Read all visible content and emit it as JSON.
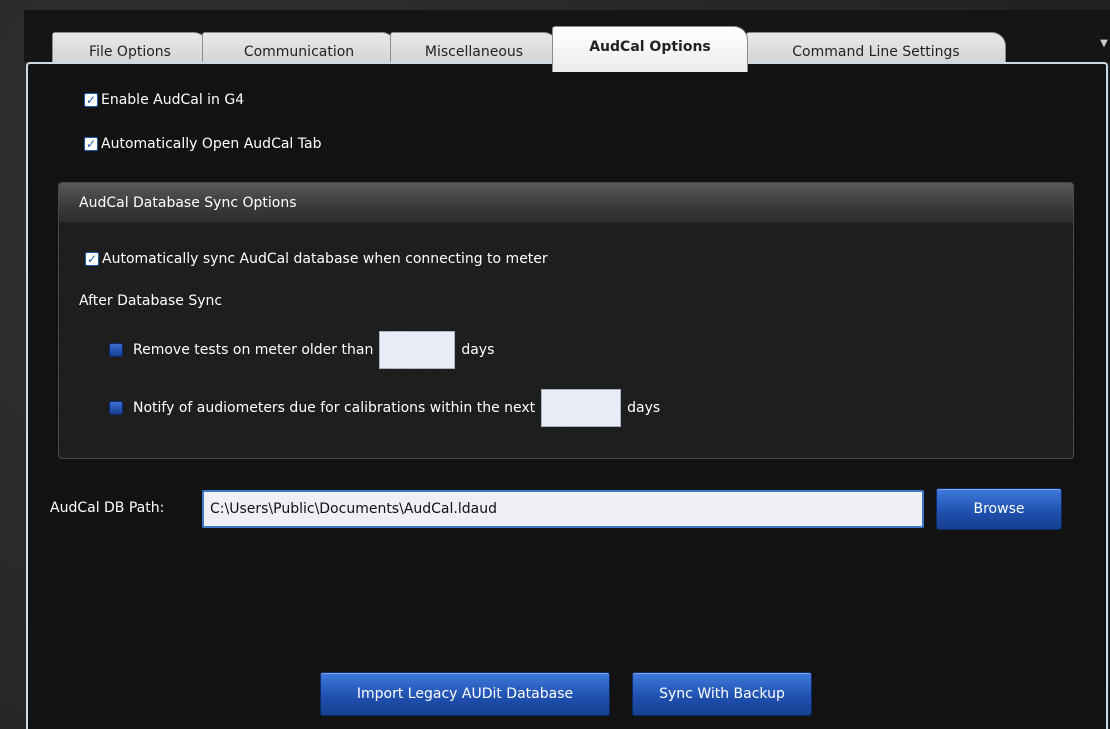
{
  "tabs": [
    {
      "label": "File Options"
    },
    {
      "label": "Communication"
    },
    {
      "label": "Miscellaneous"
    },
    {
      "label": "AudCal Options",
      "active": true
    },
    {
      "label": "Command Line Settings"
    }
  ],
  "tab_overflow_icon": "chevron-down-icon",
  "options": {
    "enable_audcal": {
      "label": "Enable AudCal in G4",
      "checked": true
    },
    "auto_open_tab": {
      "label": "Automatically Open AudCal Tab",
      "checked": true
    }
  },
  "sync_group": {
    "header": "AudCal Database Sync Options",
    "auto_sync": {
      "label": "Automatically sync AudCal database when connecting to meter",
      "checked": true
    },
    "after_sync_label": "After Database Sync",
    "remove_tests": {
      "label": "Remove tests on meter older than",
      "checked": false,
      "value": "",
      "unit": "days"
    },
    "notify": {
      "label": "Notify of audiometers due for calibrations within the next",
      "checked": false,
      "value": "",
      "unit": "days"
    }
  },
  "db_path": {
    "label": "AudCal DB Path:",
    "value": "C:\\Users\\Public\\Documents\\AudCal.ldaud",
    "browse_label": "Browse"
  },
  "actions": {
    "import_label": "Import Legacy AUDit Database",
    "sync_backup_label": "Sync With Backup"
  },
  "colors": {
    "accent_button": "#1e4fad",
    "panel_border": "#cfd9e2",
    "panel_bg": "#121212"
  }
}
